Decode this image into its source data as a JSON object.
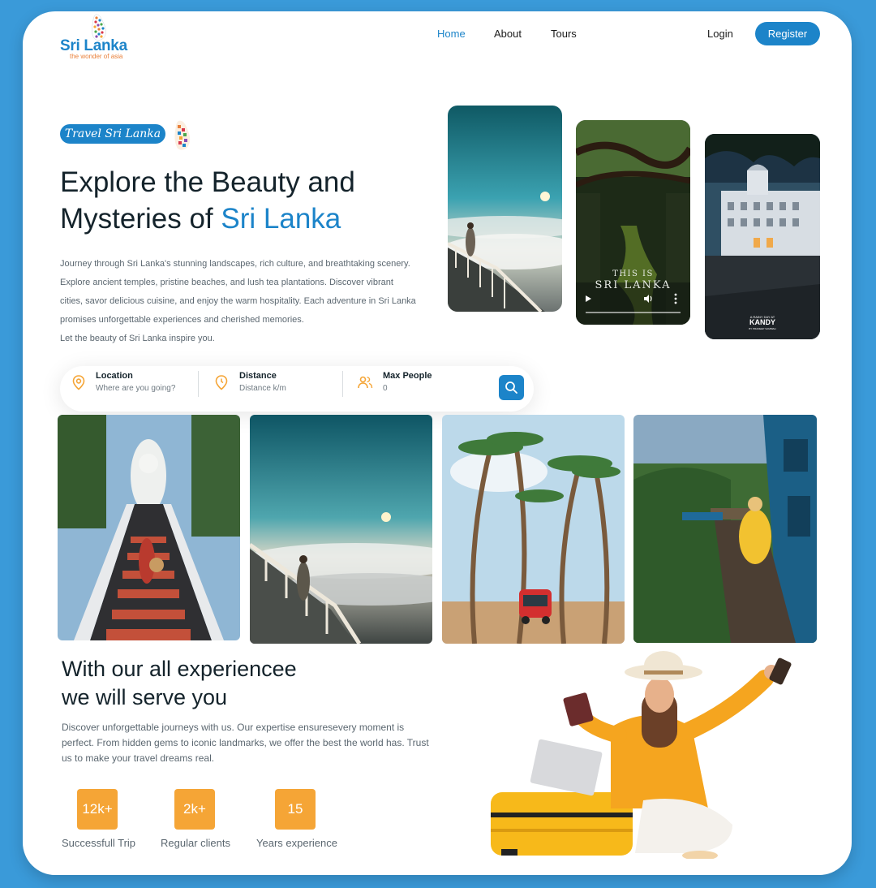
{
  "brand": {
    "name": "Sri Lanka",
    "tagline": "the wonder of asia",
    "primary_color": "#1c84c9",
    "accent_color": "#f5a536"
  },
  "nav": {
    "home": "Home",
    "about": "About",
    "tours": "Tours",
    "login": "Login",
    "register": "Register"
  },
  "hero": {
    "badge": "Travel Sri Lanka",
    "title_line1": "Explore the Beauty and",
    "title_line2_prefix": "Mysteries of ",
    "title_line2_accent": "Sri Lanka",
    "description": "Journey through Sri Lanka's stunning landscapes, rich culture, and breathtaking scenery. Explore ancient temples, pristine beaches, and lush tea plantations. Discover vibrant cities, savor delicious cuisine, and enjoy the warm hospitality. Each adventure in Sri Lanka promises unforgettable experiences and cherished memories.",
    "description_line2": "Let the beauty of Sri Lanka inspire you.",
    "phones": [
      {
        "icon": "sunrise-cliff-photo"
      },
      {
        "icon": "forest-video-player",
        "caption_line1": "THIS IS",
        "caption_line2": "SRI LANKA"
      },
      {
        "icon": "kandy-hotel-photo",
        "caption_small": "A RAINY DAY AT",
        "caption_big": "KANDY",
        "caption_credit": "BY PRADEEP SAMBIAH"
      }
    ]
  },
  "search": {
    "location_label": "Location",
    "location_placeholder": "Where are you going?",
    "distance_label": "Distance",
    "distance_placeholder": "Distance k/m",
    "people_label": "Max People",
    "people_value": "0"
  },
  "gallery": [
    {
      "icon": "temple-stairs-photo"
    },
    {
      "icon": "mountain-sunrise-photo"
    },
    {
      "icon": "palm-beach-tuktuk-photo"
    },
    {
      "icon": "train-bridge-photo"
    }
  ],
  "experience": {
    "title_line1": "With our all experiencee",
    "title_line2": "we will serve you",
    "description": "Discover unforgettable journeys with us. Our expertise ensuresevery moment is perfect. From hidden gems to iconic landmarks, we offer the best the world has. Trust us to make your travel dreams real.",
    "stats": [
      {
        "value": "12k+",
        "label": "Successfull Trip"
      },
      {
        "value": "2k+",
        "label": "Regular clients"
      },
      {
        "value": "15",
        "label": "Years experience"
      }
    ]
  }
}
